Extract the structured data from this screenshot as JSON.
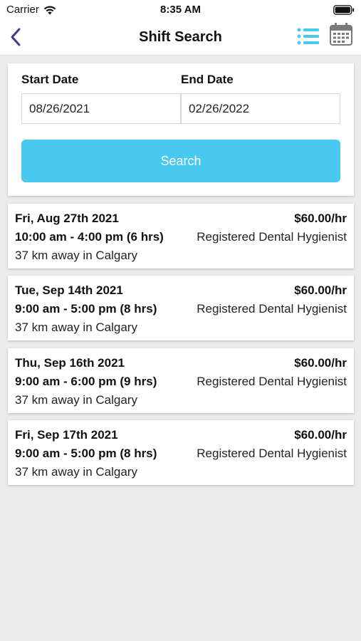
{
  "status_bar": {
    "carrier": "Carrier",
    "time": "8:35 AM"
  },
  "nav": {
    "title": "Shift Search",
    "accent_color": "#4ac9f0",
    "back_color": "#3b3a8c",
    "icons": [
      "chevron-left-icon",
      "list-icon",
      "calendar-icon"
    ]
  },
  "search": {
    "start_label": "Start Date",
    "start_value": "08/26/2021",
    "end_label": "End Date",
    "end_value": "02/26/2022",
    "button_label": "Search"
  },
  "shifts": [
    {
      "date": "Fri, Aug 27th 2021",
      "rate": "$60.00/hr",
      "time": "10:00 am - 4:00 pm (6 hrs)",
      "role": "Registered Dental Hygienist",
      "location": "37 km away in Calgary"
    },
    {
      "date": "Tue, Sep 14th 2021",
      "rate": "$60.00/hr",
      "time": "9:00 am - 5:00 pm (8 hrs)",
      "role": "Registered Dental Hygienist",
      "location": "37 km away in Calgary"
    },
    {
      "date": "Thu, Sep 16th 2021",
      "rate": "$60.00/hr",
      "time": "9:00 am - 6:00 pm (9 hrs)",
      "role": "Registered Dental Hygienist",
      "location": "37 km away in Calgary"
    },
    {
      "date": "Fri, Sep 17th 2021",
      "rate": "$60.00/hr",
      "time": "9:00 am - 5:00 pm (8 hrs)",
      "role": "Registered Dental Hygienist",
      "location": "37 km away in Calgary"
    }
  ]
}
